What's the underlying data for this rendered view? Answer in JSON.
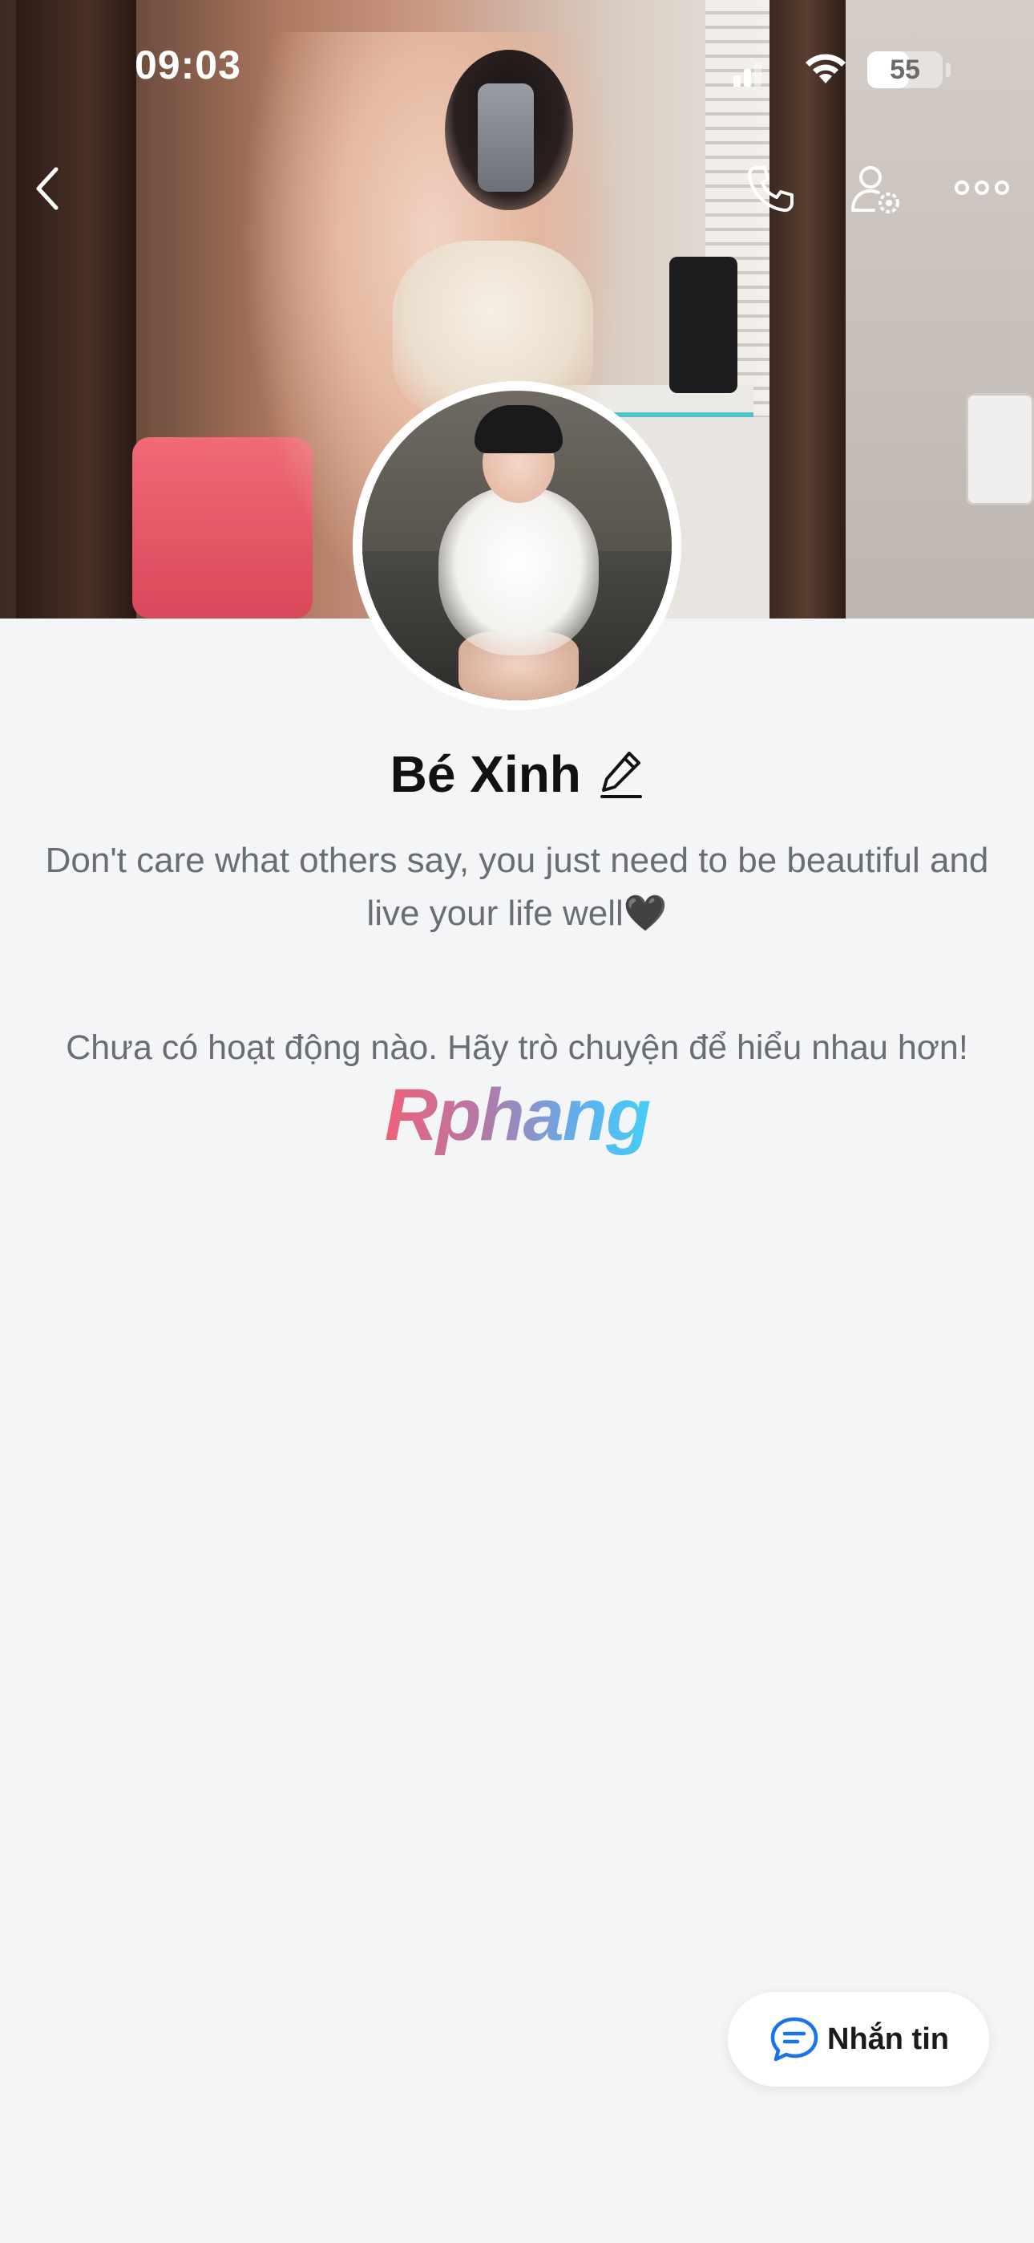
{
  "status_bar": {
    "time": "09:03",
    "battery_percent": "55",
    "battery_level": 0.55
  },
  "nav": {
    "back_icon": "chevron-left-icon",
    "call_icon": "phone-icon",
    "settings_icon": "user-settings-icon",
    "more_icon": "more-horizontal-icon"
  },
  "profile": {
    "name": "Bé Xinh",
    "edit_icon": "pencil-icon",
    "bio": "Don't care what others say, you just need to be beautiful and live your life well🖤",
    "empty_activity": "Chưa có hoạt động nào. Hãy trò chuyện để hiểu nhau hơn!"
  },
  "watermark": {
    "text": "Rphang"
  },
  "message_button": {
    "label": "Nhắn tin",
    "icon": "chat-bubble-icon",
    "accent": "#1a73e8"
  },
  "colors": {
    "background": "#f4f5f7",
    "text_primary": "#111111",
    "text_secondary": "#6a6d72"
  }
}
